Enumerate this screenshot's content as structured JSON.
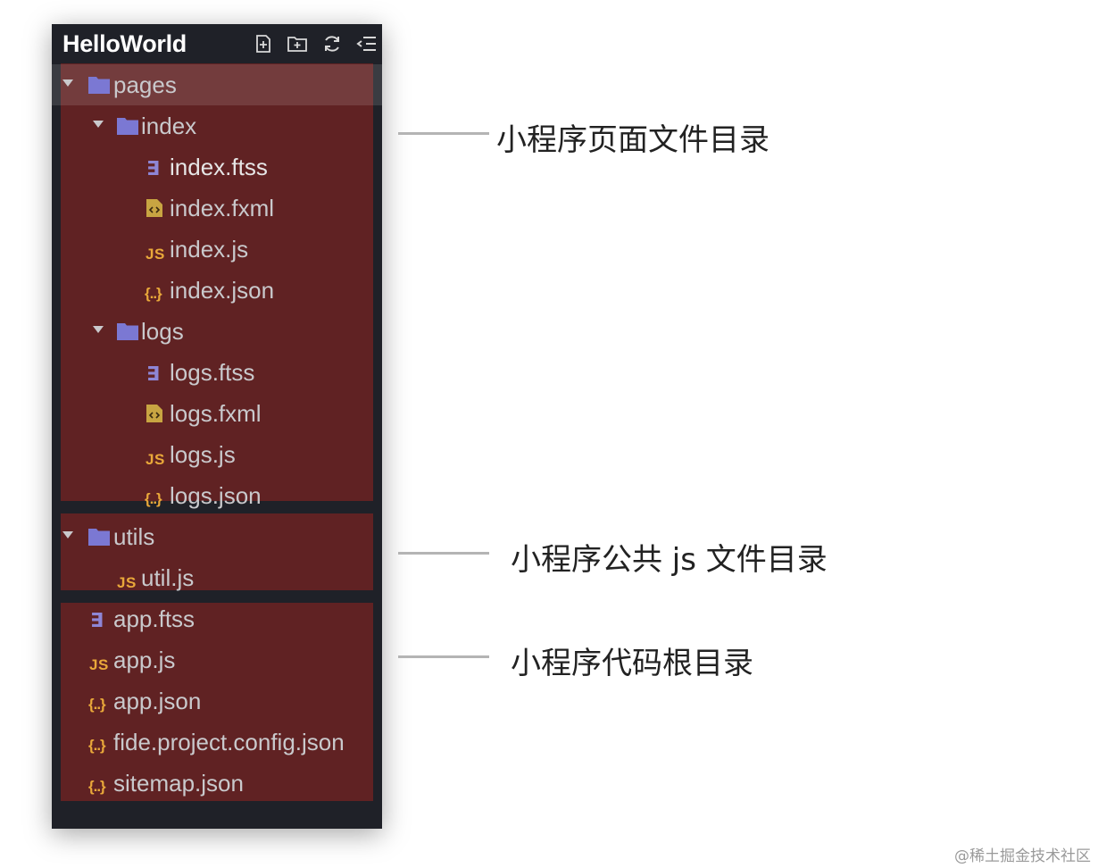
{
  "panel": {
    "title": "HelloWorld",
    "header_icons": [
      "new-file-icon",
      "new-folder-icon",
      "refresh-icon",
      "collapse-all-icon"
    ]
  },
  "tree": {
    "pages": "pages",
    "index": "index",
    "index_ftss": "index.ftss",
    "index_fxml": "index.fxml",
    "index_js": "index.js",
    "index_json": "index.json",
    "logs": "logs",
    "logs_ftss": "logs.ftss",
    "logs_fxml": "logs.fxml",
    "logs_js": "logs.js",
    "logs_json": "logs.json",
    "utils": "utils",
    "util_js": "util.js",
    "app_ftss": "app.ftss",
    "app_js": "app.js",
    "app_json": "app.json",
    "fide_config": "fide.project.config.json",
    "sitemap": "sitemap.json"
  },
  "icons": {
    "js_glyph": "JS",
    "json_glyph": "{..}",
    "css_glyph": "∃"
  },
  "annotations": {
    "pages": "小程序页面文件目录",
    "utils": "小程序公共 js 文件目录",
    "root": "小程序代码根目录"
  },
  "watermark": "@稀土掘金技术社区",
  "colors": {
    "panel_bg": "#1f2128",
    "highlight": "#732323",
    "folder": "#7b78d3",
    "js": "#e9a83a",
    "text": "#c9c9cc"
  }
}
